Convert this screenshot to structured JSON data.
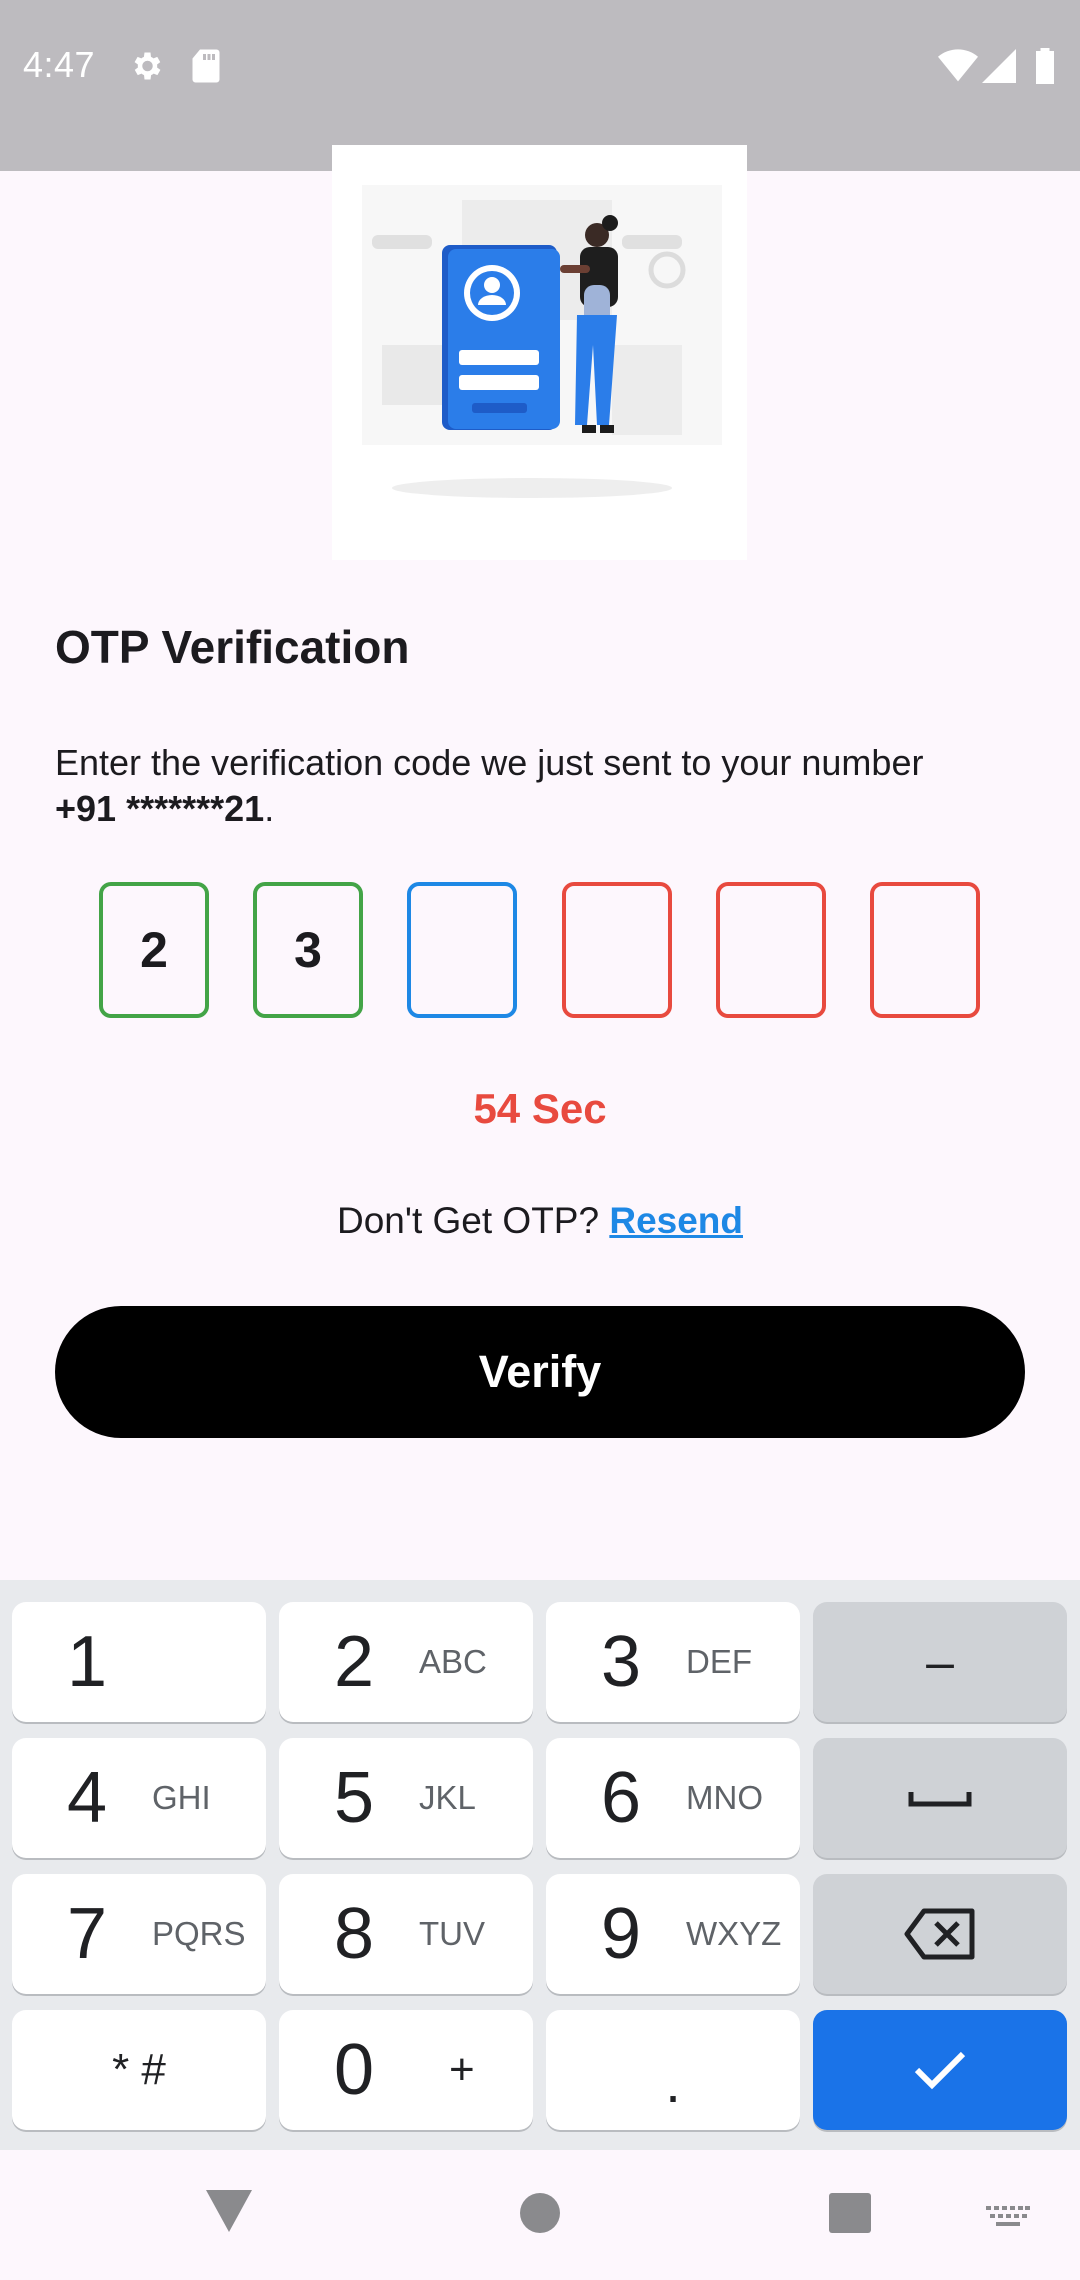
{
  "status_bar": {
    "time": "4:47",
    "icons": [
      "gear-icon",
      "sd-card-icon",
      "wifi-icon",
      "signal-icon",
      "battery-icon"
    ]
  },
  "illustration": {
    "name": "person-login-illustration"
  },
  "title": "OTP Verification",
  "subtitle": {
    "text": "Enter the verification code we just sent to your number",
    "phone": "+91 *******21",
    "period": "."
  },
  "otp": {
    "digits": [
      "2",
      "3",
      "",
      "",
      "",
      ""
    ],
    "colors": {
      "filled": "#43a447",
      "active": "#1e88e5",
      "empty": "#e84a3f"
    }
  },
  "timer": "54 Sec",
  "resend": {
    "prompt": "Don't Get OTP?",
    "link": "Resend"
  },
  "verify_button": "Verify",
  "keyboard": {
    "keys": [
      {
        "digit": "1",
        "letters": ""
      },
      {
        "digit": "2",
        "letters": "ABC"
      },
      {
        "digit": "3",
        "letters": "DEF"
      },
      {
        "symbol": "–"
      },
      {
        "digit": "4",
        "letters": "GHI"
      },
      {
        "digit": "5",
        "letters": "JKL"
      },
      {
        "digit": "6",
        "letters": "MNO"
      },
      {
        "symbol": "space-icon"
      },
      {
        "digit": "7",
        "letters": "PQRS"
      },
      {
        "digit": "8",
        "letters": "TUV"
      },
      {
        "digit": "9",
        "letters": "WXYZ"
      },
      {
        "symbol": "backspace-icon"
      },
      {
        "label": "* #"
      },
      {
        "digit": "0",
        "letters": "+"
      },
      {
        "label": "."
      },
      {
        "symbol": "check-icon"
      }
    ],
    "enter_color": "#1a73e8"
  },
  "nav_bar": {
    "icons": [
      "back-icon",
      "home-icon",
      "recents-icon",
      "keyboard-switch-icon"
    ]
  }
}
